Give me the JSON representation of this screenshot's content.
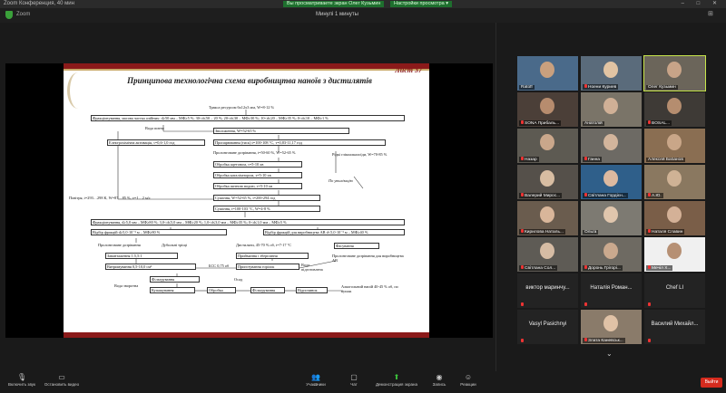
{
  "window": {
    "app_title": "Zoom Конференция, 40 мин",
    "banner_viewing": "Вы просматриваете экран Олег Кузьмин",
    "banner_view_options": "Настройки просмотра ▾",
    "window_controls": "– □ ✕"
  },
  "topbar": {
    "left_label": "Zoom",
    "center_label": "Минулі 1 минуты",
    "view_button": "⊞"
  },
  "slide": {
    "sheet": "Лист 37",
    "title": "Принципова технологічна схема виробництва нанoїв з дистилятів",
    "boxes": [
      "Фракціонування, масова частка олійних: d≥50 мм – МФ≥5 %; 30<d≤50 – 20 %; 20<d≤30 – МФ≥30 %; 10<d≤20 – МФ≥35 %; 0<d≤10 – МФ≥1 %",
      "Вода питна",
      "Зволоження, W=52-65 %",
      "Електрохімічна активація, τ=0,6-1,0 год",
      "Пропарювання (тиск) t=100-108 °С, τ=0,83-11,17 год",
      "Пролонговане дозрівання, t=50-60 %, W=52-65 %",
      "Рідкі глікоалкалоїди, W=70-85 %",
      "Обробка ацетоном, τ=5-10 хв",
      "Обробка каталізатором, τ=5-10 хв",
      "По утилізацію",
      "Обробка питною водою, τ=5-10 хв",
      "Повітря, t=293…298 К, W=87…85 %, v=1…2 м/с",
      "Сушіння, W=52-65 %, t=200-294 год",
      "Сушіння, t=100-103 °С, W=4-8 %",
      "Фракціонування, d≥5,0 мм – МФ≥80 %; 3,0<d≤5,0 мм – МФ≥20 %; 1,0<d≤3,0 мм – МФ≥35 %; 0<d≤1,0 мм – МФ≥5 %",
      "Відбір фракцій d≥5,0·10⁻³ м – МФ≥80 %",
      "Відбір фракцій для виробництва АВ d<5,0·10⁻³ м – МФ≥40 %",
      "Пролонговане дозрівання",
      "Дубильні тріщі",
      "Дистиляти, 45-70 % об, t=7-17 °С",
      "Фасування",
      "Завантаження 1:5,5:1",
      "Приймання і зберігання",
      "Пролонговане дозрівання для виробництва АВ",
      "Витримування 0,5-10,0 см³",
      "БСС 0,75 об",
      "Приготування горілок",
      "Вода підготовлена",
      "Фільтрування",
      "Осад",
      "Вода зворотна",
      "Купажування",
      "Обробка",
      "Фільтрування",
      "Відпочинок",
      "Алкогольний напій 40-45 % об, по купаж",
      "Тракса ресурсом 6х12х3 мм, W=8-12 %"
    ]
  },
  "participants": [
    {
      "name": "Ratoff",
      "color": "#4a6a8a",
      "head": "#c9a07e",
      "muted": false,
      "active": false
    },
    {
      "name": "Ноени Куриев",
      "color": "#5a6b7b",
      "head": "#e2c4a3",
      "muted": true,
      "active": false
    },
    {
      "name": "Олег Кузьмин",
      "color": "#6b655a",
      "head": "#c8a488",
      "muted": false,
      "active": true
    },
    {
      "name": "SONA Прибаль...",
      "color": "#4b3f38",
      "head": "#b78c6e",
      "muted": true,
      "active": false
    },
    {
      "name": "Анатолій",
      "color": "#7a7468",
      "head": "#d0b096",
      "muted": false,
      "active": false
    },
    {
      "name": "BOSAL...",
      "color": "#3e3a36",
      "head": "#b58d6f",
      "muted": true,
      "active": false
    },
    {
      "name": "Назар",
      "color": "#5d5a52",
      "head": "#caa78b",
      "muted": true,
      "active": false
    },
    {
      "name": "Ганна",
      "color": "#6d6a64",
      "head": "#d3b59c",
      "muted": true,
      "active": false
    },
    {
      "name": "Алексей Бабанов",
      "color": "#8a6e52",
      "head": "#c9a688",
      "muted": false,
      "active": false
    },
    {
      "name": "Валерий Мирос...",
      "color": "#55504a",
      "head": "#d8bda2",
      "muted": true,
      "active": false
    },
    {
      "name": "Світлана Гордієн...",
      "color": "#2f5f8a",
      "head": "#dcb9a0",
      "muted": true,
      "active": false
    },
    {
      "name": "А.Ю.",
      "color": "#8a7860",
      "head": "#cfb295",
      "muted": true,
      "active": false
    },
    {
      "name": "Кирилова Наталь...",
      "color": "#6a5c4e",
      "head": "#d9b69a",
      "muted": true,
      "active": false
    },
    {
      "name": "Ольга",
      "color": "#7d7a72",
      "head": "#e0c6ad",
      "muted": false,
      "active": false
    },
    {
      "name": "Наталя Славин",
      "color": "#7a5e48",
      "head": "#d4b197",
      "muted": true,
      "active": false
    },
    {
      "name": "Світлана Сол...",
      "color": "#5e5b55",
      "head": "#d6bca4",
      "muted": true,
      "active": false
    },
    {
      "name": "Доронь Грігорі...",
      "color": "#6e6a62",
      "head": "#caa98e",
      "muted": true,
      "active": false
    },
    {
      "name": "Мечіл Х...",
      "color": "#f0f0f0",
      "head": "#b69074",
      "muted": true,
      "active": false
    },
    {
      "name": "виктор маринчу...",
      "text_only": true,
      "muted": true
    },
    {
      "name": "Наталія Роман...",
      "text_only": true,
      "muted": true
    },
    {
      "name": "Chef LI",
      "text_only": true,
      "muted": true
    },
    {
      "name": "Vasyl Pasichnyi",
      "text_only": true,
      "muted": true
    },
    {
      "name": "Злата Каневськ...",
      "color": "#8a7b6a",
      "head": "#e0c2a6",
      "muted": true,
      "active": false
    },
    {
      "name": "Василий Михайл...",
      "text_only": true,
      "muted": true
    }
  ],
  "gallery_next": "⌄",
  "toolbar": {
    "audio": "Включить звук",
    "video": "Остановить видео",
    "participants": "Участники",
    "participants_count": "47",
    "chat": "Чат",
    "share": "Демонстрация экрана",
    "record": "Запись",
    "reactions": "Реакции",
    "leave": "Выйти"
  }
}
